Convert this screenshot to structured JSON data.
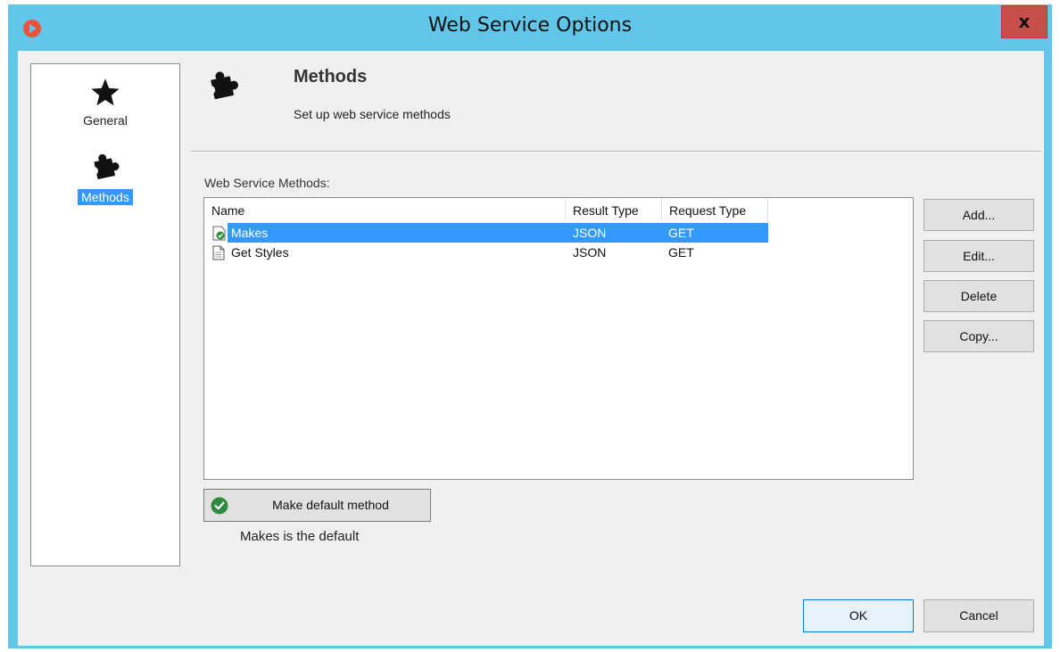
{
  "window": {
    "title": "Web Service Options",
    "close_label": "x",
    "titlebar_color": "#61c6ea",
    "close_color": "#c7504b"
  },
  "sidebar": {
    "items": [
      {
        "label": "General",
        "icon": "star-icon",
        "selected": false
      },
      {
        "label": "Methods",
        "icon": "puzzle-icon",
        "selected": true
      }
    ],
    "selected_color": "#3399ff"
  },
  "header": {
    "title": "Methods",
    "subtitle": "Set up web service methods",
    "icon": "puzzle-icon"
  },
  "methods": {
    "label": "Web Service Methods:",
    "columns": [
      "Name",
      "Result Type",
      "Request Type"
    ],
    "rows": [
      {
        "name": "Makes",
        "result_type": "JSON",
        "request_type": "GET",
        "icon": "default-method-icon",
        "selected": true
      },
      {
        "name": "Get Styles",
        "result_type": "JSON",
        "request_type": "GET",
        "icon": "document-icon",
        "selected": false
      }
    ]
  },
  "actions": {
    "add": "Add...",
    "edit": "Edit...",
    "delete": "Delete",
    "copy": "Copy..."
  },
  "default_method": {
    "button_label": "Make default method",
    "icon": "check-circle-icon",
    "status": "Makes is the default"
  },
  "footer": {
    "ok": "OK",
    "cancel": "Cancel"
  }
}
